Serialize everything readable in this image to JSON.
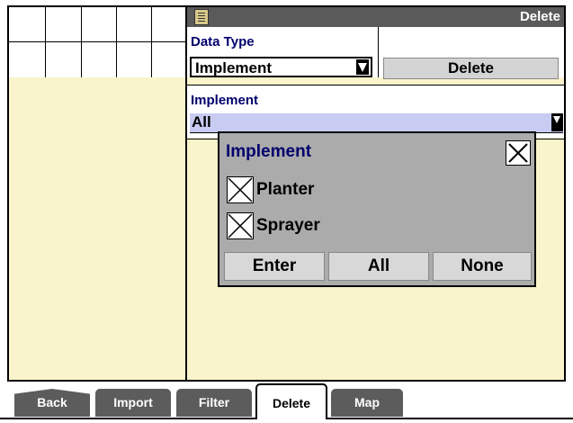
{
  "header": {
    "title": "Delete"
  },
  "data_type": {
    "label": "Data Type",
    "value": "Implement",
    "delete_label": "Delete"
  },
  "implement": {
    "label": "Implement",
    "value": "All"
  },
  "popup": {
    "title": "Implement",
    "items": [
      {
        "label": "Planter",
        "checked": true
      },
      {
        "label": "Sprayer",
        "checked": true
      }
    ],
    "buttons": {
      "enter": "Enter",
      "all": "All",
      "none": "None"
    }
  },
  "tabs": [
    {
      "label": "Back",
      "active": false
    },
    {
      "label": "Import",
      "active": false
    },
    {
      "label": "Filter",
      "active": false
    },
    {
      "label": "Delete",
      "active": true
    },
    {
      "label": "Map",
      "active": false
    }
  ],
  "colors": {
    "panel_bg": "#f9f4cc",
    "titlebar": "#5a5a5a",
    "label_blue": "#00006e",
    "popup_bg": "#ababab",
    "tab_bg": "#5c5c5c",
    "selected_bg": "#c8ccf2"
  }
}
